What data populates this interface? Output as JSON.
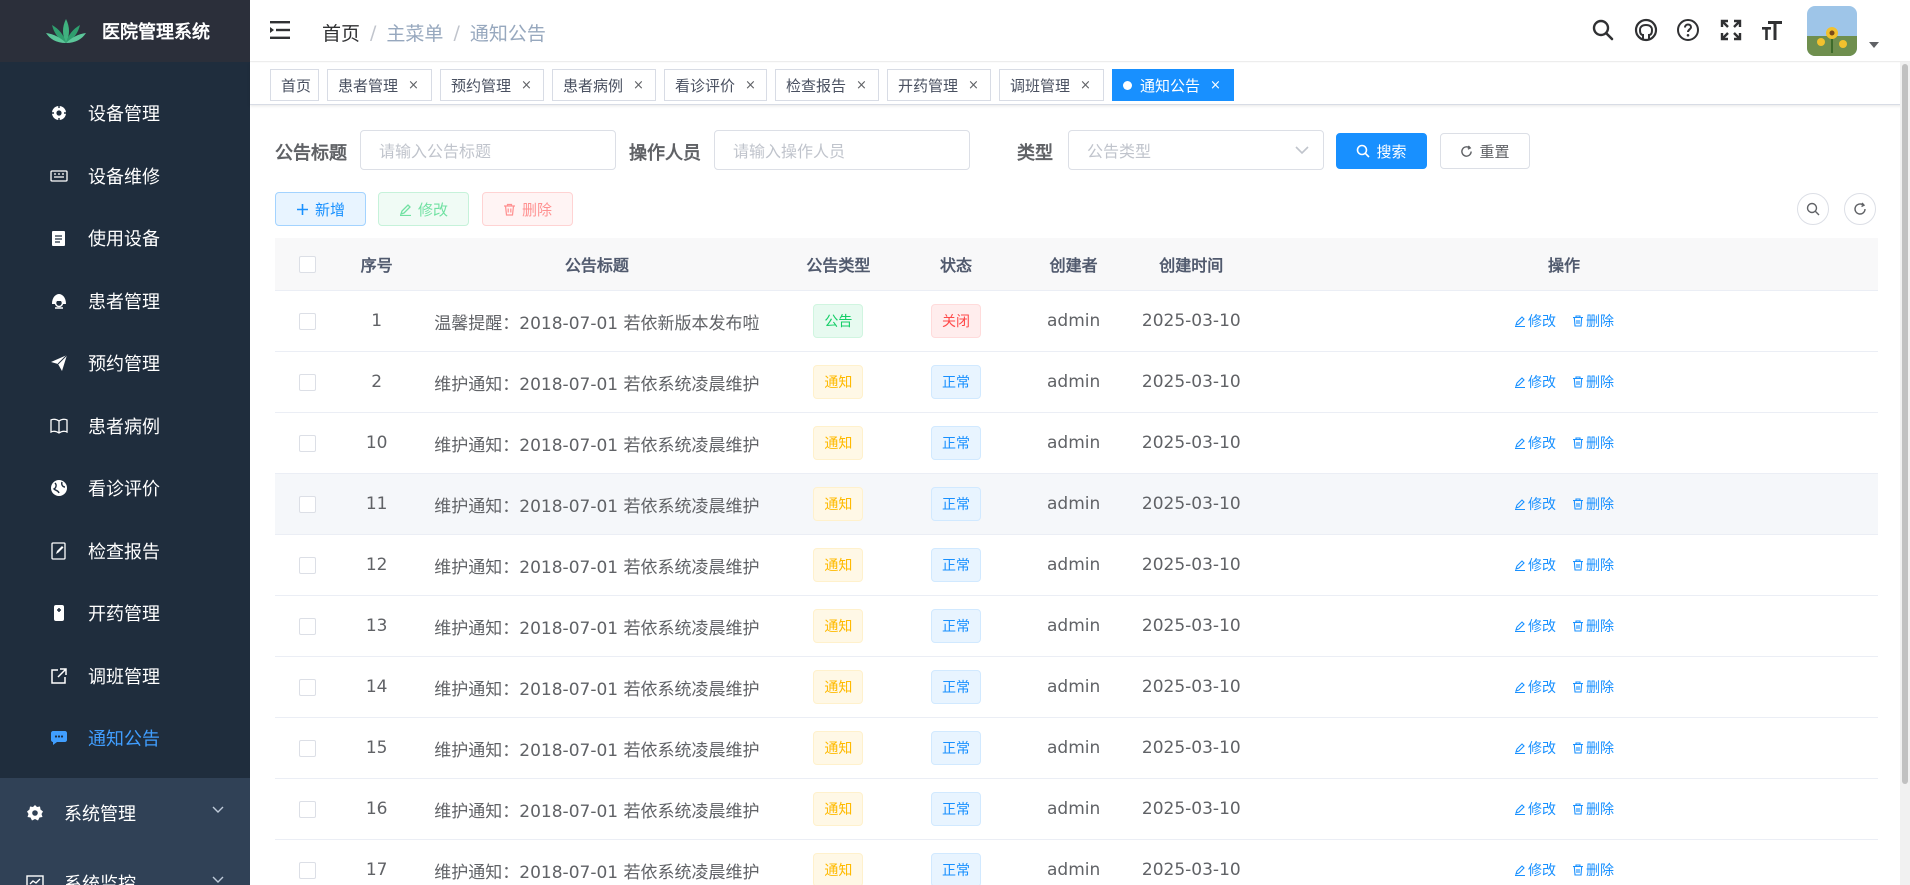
{
  "app": {
    "title": "医院管理系统"
  },
  "sidebar": {
    "items": [
      {
        "label": "设备管理",
        "icon": "gear-cog-icon"
      },
      {
        "label": "设备维修",
        "icon": "keyboard-icon"
      },
      {
        "label": "使用设备",
        "icon": "clipboard-icon"
      },
      {
        "label": "患者管理",
        "icon": "user-icon"
      },
      {
        "label": "预约管理",
        "icon": "paper-plane-icon"
      },
      {
        "label": "患者病例",
        "icon": "book-icon"
      },
      {
        "label": "看诊评价",
        "icon": "globe-icon"
      },
      {
        "label": "检查报告",
        "icon": "edit-document-icon"
      },
      {
        "label": "开药管理",
        "icon": "pill-icon"
      },
      {
        "label": "调班管理",
        "icon": "external-link-icon"
      },
      {
        "label": "通知公告",
        "icon": "message-icon",
        "active": true
      }
    ],
    "groups": [
      {
        "label": "系统管理",
        "icon": "settings-icon"
      },
      {
        "label": "系统监控",
        "icon": "monitor-icon"
      }
    ]
  },
  "breadcrumb": {
    "home": "首页",
    "menu": "主菜单",
    "current": "通知公告"
  },
  "tags": [
    {
      "label": "首页",
      "closable": false
    },
    {
      "label": "患者管理",
      "closable": true
    },
    {
      "label": "预约管理",
      "closable": true
    },
    {
      "label": "患者病例",
      "closable": true
    },
    {
      "label": "看诊评价",
      "closable": true
    },
    {
      "label": "检查报告",
      "closable": true
    },
    {
      "label": "开药管理",
      "closable": true
    },
    {
      "label": "调班管理",
      "closable": true
    },
    {
      "label": "通知公告",
      "closable": true,
      "active": true
    }
  ],
  "search": {
    "title_label": "公告标题",
    "title_placeholder": "请输入公告标题",
    "operator_label": "操作人员",
    "operator_placeholder": "请输入操作人员",
    "type_label": "类型",
    "type_placeholder": "公告类型",
    "search_button": "搜索",
    "reset_button": "重置"
  },
  "toolbar": {
    "add": "新增",
    "edit": "修改",
    "delete": "删除"
  },
  "table": {
    "headers": {
      "no": "序号",
      "title": "公告标题",
      "type": "公告类型",
      "status": "状态",
      "creator": "创建者",
      "time": "创建时间",
      "op": "操作"
    },
    "edit_label": "修改",
    "delete_label": "删除",
    "rows": [
      {
        "no": "1",
        "title": "温馨提醒：2018-07-01 若依新版本发布啦",
        "type": "公告",
        "status": "关闭",
        "creator": "admin",
        "time": "2025-03-10"
      },
      {
        "no": "2",
        "title": "维护通知：2018-07-01 若依系统凌晨维护",
        "type": "通知",
        "status": "正常",
        "creator": "admin",
        "time": "2025-03-10"
      },
      {
        "no": "10",
        "title": "维护通知：2018-07-01 若依系统凌晨维护",
        "type": "通知",
        "status": "正常",
        "creator": "admin",
        "time": "2025-03-10"
      },
      {
        "no": "11",
        "title": "维护通知：2018-07-01 若依系统凌晨维护",
        "type": "通知",
        "status": "正常",
        "creator": "admin",
        "time": "2025-03-10"
      },
      {
        "no": "12",
        "title": "维护通知：2018-07-01 若依系统凌晨维护",
        "type": "通知",
        "status": "正常",
        "creator": "admin",
        "time": "2025-03-10"
      },
      {
        "no": "13",
        "title": "维护通知：2018-07-01 若依系统凌晨维护",
        "type": "通知",
        "status": "正常",
        "creator": "admin",
        "time": "2025-03-10"
      },
      {
        "no": "14",
        "title": "维护通知：2018-07-01 若依系统凌晨维护",
        "type": "通知",
        "status": "正常",
        "creator": "admin",
        "time": "2025-03-10"
      },
      {
        "no": "15",
        "title": "维护通知：2018-07-01 若依系统凌晨维护",
        "type": "通知",
        "status": "正常",
        "creator": "admin",
        "time": "2025-03-10"
      },
      {
        "no": "16",
        "title": "维护通知：2018-07-01 若依系统凌晨维护",
        "type": "通知",
        "status": "正常",
        "creator": "admin",
        "time": "2025-03-10"
      },
      {
        "no": "17",
        "title": "维护通知：2018-07-01 若依系统凌晨维护",
        "type": "通知",
        "status": "正常",
        "creator": "admin",
        "time": "2025-03-10"
      }
    ]
  },
  "colors": {
    "sidebar": "#304156",
    "accent": "#1890ff"
  }
}
